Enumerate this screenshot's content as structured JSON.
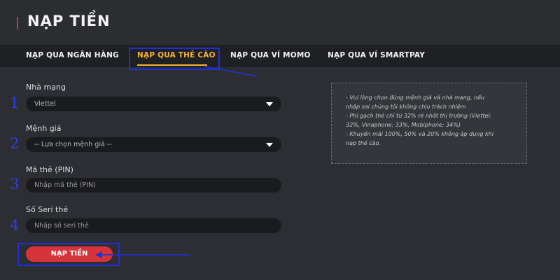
{
  "header": {
    "title": "NẠP TIỀN"
  },
  "tabs": [
    {
      "label": "NẠP QUA NGÂN HÀNG",
      "active": false
    },
    {
      "label": "NẠP QUA THẺ CÀO",
      "active": true
    },
    {
      "label": "NẠP QUA VÍ MOMO",
      "active": false
    },
    {
      "label": "NẠP QUA VÍ SMARTPAY",
      "active": false
    }
  ],
  "form": {
    "network": {
      "label": "Nhà mạng",
      "value": "Viettel",
      "step": "1"
    },
    "denomination": {
      "label": "Mệnh giá",
      "value": "-- Lựa chọn mệnh giá --",
      "step": "2"
    },
    "pin": {
      "label": "Mã thẻ (PIN)",
      "placeholder": "Nhập mã thẻ (PIN)",
      "step": "3"
    },
    "serial": {
      "label": "Số Seri thẻ",
      "placeholder": "Nhập số seri thẻ",
      "step": "4"
    },
    "submit_label": "NẠP TIỀN"
  },
  "info": {
    "lines": [
      "- Vui lòng chọn đúng mệnh giá và nhà mạng, nếu",
      "nhập sai chúng tôi không chịu trách nhiệm",
      "- Phí gạch thẻ chỉ từ 32% rẻ nhất thị trường (Viettel:",
      "32%, Vinaphone: 33%, Mobiphone: 34%)",
      "- Khuyến mãi 100%, 50% và 20% không áp dụng khi",
      "nạp thẻ cào."
    ]
  },
  "colors": {
    "accent": "#f4b23a",
    "button": "#d6333a",
    "annotation": "#1f2fd9"
  }
}
